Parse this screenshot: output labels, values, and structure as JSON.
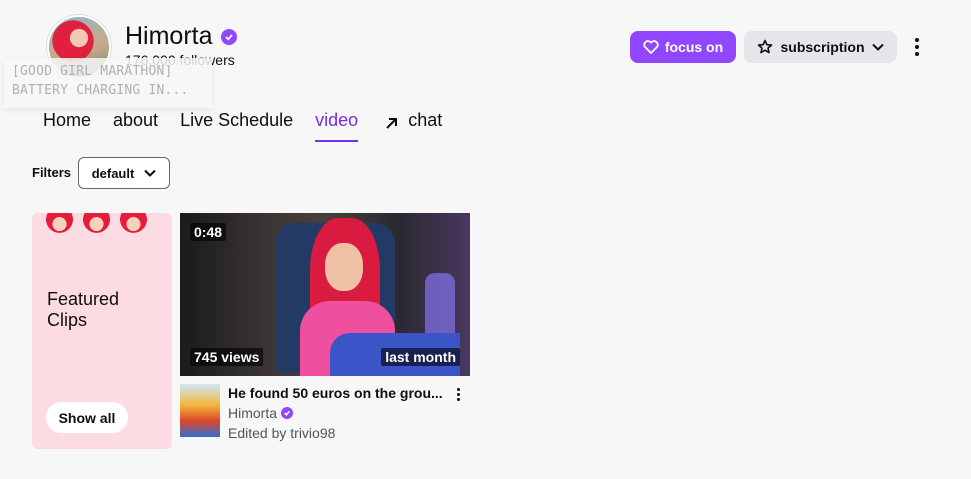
{
  "channel": {
    "name": "Himorta",
    "followers": "176,000 followers",
    "tooltip_lines": [
      "[GOOD GIRL MARATHON]",
      "BATTERY CHARGING IN..."
    ]
  },
  "actions": {
    "follow_label": "focus on",
    "follow_icon": "heart-icon",
    "subscribe_label": "subscription",
    "subscribe_icon": "star-icon"
  },
  "tabs": [
    {
      "label": "Home"
    },
    {
      "label": "about"
    },
    {
      "label": "Live Schedule"
    },
    {
      "label": "video",
      "active": true
    },
    {
      "label": "chat",
      "icon": "external-arrow-icon"
    }
  ],
  "filters": {
    "label": "Filters",
    "selected": "default"
  },
  "featured": {
    "title": "Featured Clips",
    "button": "Show all"
  },
  "clip": {
    "duration": "0:48",
    "views": "745 views",
    "date": "last month",
    "title": "He found 50 euros on the grou...",
    "channel": "Himorta",
    "editor": "Edited by trivio98"
  },
  "colors": {
    "accent": "#9147ff",
    "active_tab": "#772ce8",
    "featured_bg": "#fcdbe2"
  }
}
